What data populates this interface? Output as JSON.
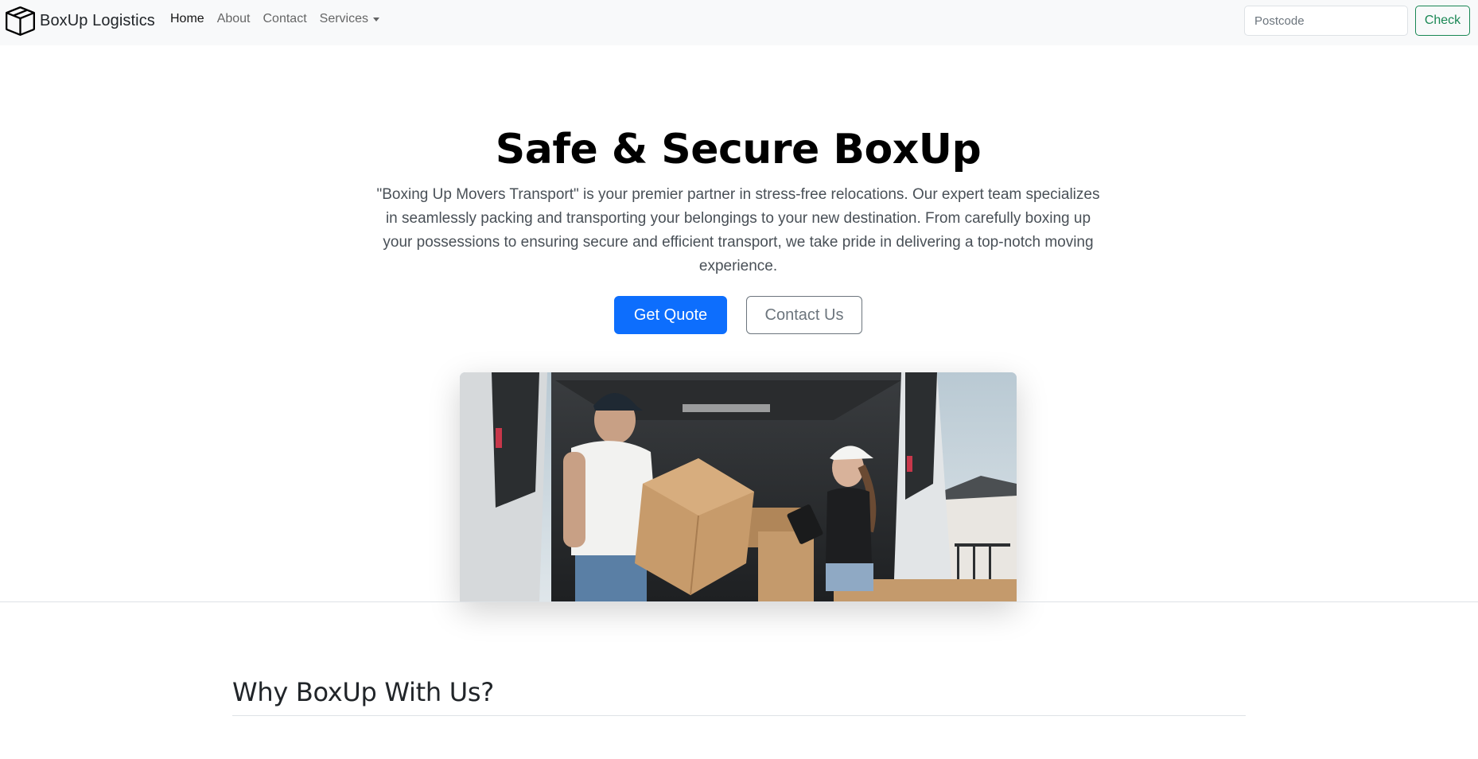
{
  "nav": {
    "brand": "BoxUp Logistics",
    "links": [
      {
        "label": "Home",
        "active": true
      },
      {
        "label": "About",
        "active": false
      },
      {
        "label": "Contact",
        "active": false
      },
      {
        "label": "Services",
        "active": false,
        "dropdown": true
      }
    ],
    "search": {
      "placeholder": "Postcode",
      "value": ""
    },
    "check_label": "Check"
  },
  "hero": {
    "title": "Safe & Secure BoxUp",
    "lead": "\"Boxing Up Movers Transport\" is your premier partner in stress-free relocations. Our expert team specializes in seamlessly packing and transporting your belongings to your new destination. From carefully boxing up your possessions to ensuring secure and efficient transport, we take pride in delivering a top-notch moving experience.",
    "primary_button": "Get Quote",
    "secondary_button": "Contact Us"
  },
  "why": {
    "title": "Why BoxUp With Us?"
  },
  "icons": {
    "brand": "box-icon",
    "dropdown": "caret-down-icon"
  },
  "colors": {
    "primary": "#0d6efd",
    "success": "#198754",
    "secondary": "#6c757d",
    "navbar_bg": "#f8f9fa"
  }
}
